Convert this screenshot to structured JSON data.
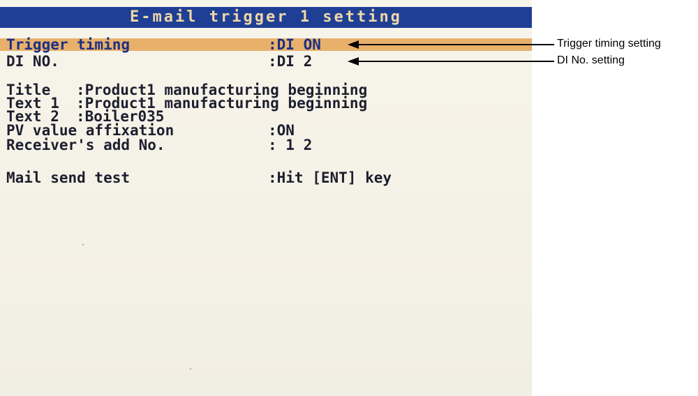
{
  "screen": {
    "title": "E-mail trigger 1 setting",
    "trigger_timing": {
      "label": "Trigger timing",
      "value": ":DI ON"
    },
    "di_no": {
      "label": "DI NO.",
      "value": ":DI 2"
    },
    "title_field": {
      "label": "Title  ",
      "value": ":Product1 manufacturing beginning"
    },
    "text1": {
      "label": "Text 1 ",
      "value": ":Product1 manufacturing beginning"
    },
    "text2": {
      "label": "Text 2 ",
      "value": ":Boiler035"
    },
    "pv_affixation": {
      "label": "PV value affixation",
      "value": ":ON"
    },
    "receiver": {
      "label": "Receiver's add No.",
      "value": ": 1 2"
    },
    "mail_test": {
      "label": "Mail send test",
      "value": ":Hit [ENT] key"
    },
    "colors": {
      "title_bar": "#1f3f95",
      "title_text": "#f0d7a8",
      "highlight": "#e8b06a",
      "text": "#1d1f2f"
    }
  },
  "annotations": {
    "trigger_timing_setting": "Trigger timing setting",
    "di_no_setting": "DI No. setting"
  }
}
